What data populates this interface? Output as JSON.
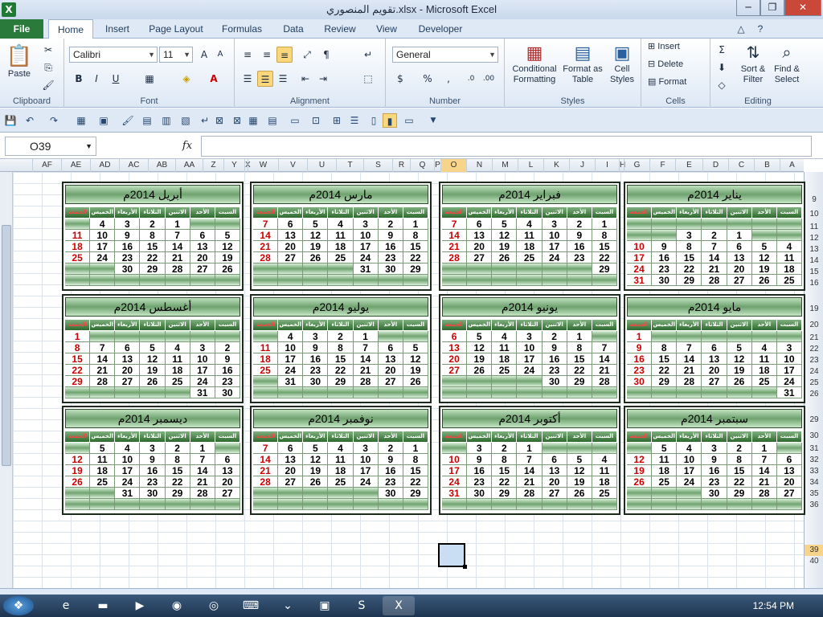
{
  "window": {
    "title": "تقويم المنصوري.xlsx  -  Microsoft Excel",
    "app_icon": "X"
  },
  "ribbon_tabs": [
    "File",
    "Home",
    "Insert",
    "Page Layout",
    "Formulas",
    "Data",
    "Review",
    "View",
    "Developer"
  ],
  "ribbon": {
    "clipboard": {
      "label": "Clipboard",
      "paste": "Paste"
    },
    "font": {
      "label": "Font",
      "name": "Calibri",
      "size": "11"
    },
    "alignment": {
      "label": "Alignment"
    },
    "number": {
      "label": "Number",
      "format": "General"
    },
    "styles": {
      "label": "Styles",
      "conditional": "Conditional Formatting",
      "table": "Format as Table",
      "cell": "Cell Styles"
    },
    "cells": {
      "label": "Cells",
      "insert": "Insert",
      "delete": "Delete",
      "format": "Format"
    },
    "editing": {
      "label": "Editing",
      "sort": "Sort & Filter",
      "find": "Find & Select"
    }
  },
  "formula_bar": {
    "name_box": "O39",
    "fx": "fx",
    "value": ""
  },
  "columns": [
    "AF",
    "AE",
    "AD",
    "AC",
    "AB",
    "AA",
    "Z",
    "Y",
    "X",
    "W",
    "V",
    "U",
    "T",
    "S",
    "R",
    "Q",
    "P",
    "O",
    "N",
    "M",
    "L",
    "K",
    "J",
    "I",
    "H",
    "G",
    "F",
    "E",
    "D",
    "C",
    "B",
    "A"
  ],
  "selected_column": "O",
  "rows": [
    "9",
    "10",
    "11",
    "12",
    "13",
    "14",
    "15",
    "16",
    "19",
    "20",
    "21",
    "22",
    "23",
    "24",
    "25",
    "26",
    "29",
    "30",
    "31",
    "32",
    "33",
    "34",
    "35",
    "36",
    "39",
    "40"
  ],
  "selected_row": "39",
  "weekdays": [
    "السبت",
    "الأحد",
    "الاثنين",
    "الثلاثاء",
    "الأربعاء",
    "الخميس",
    "الجمعة"
  ],
  "months": [
    {
      "name": "يناير  2014م",
      "weeks": [
        [
          null,
          null,
          null,
          null,
          null,
          null,
          null
        ],
        [
          "",
          "",
          "1",
          "2",
          "3"
        ],
        [
          "4",
          "5",
          "6",
          "7",
          "8",
          "9",
          "10"
        ],
        [
          "11",
          "12",
          "13",
          "14",
          "15",
          "16",
          "17"
        ],
        [
          "18",
          "19",
          "20",
          "21",
          "22",
          "23",
          "24"
        ],
        [
          "25",
          "26",
          "27",
          "28",
          "29",
          "30",
          "31"
        ]
      ]
    },
    {
      "name": "فبراير  2014م",
      "weeks": [
        [
          "1",
          "2",
          "3",
          "4",
          "5",
          "6",
          "7"
        ],
        [
          "8",
          "9",
          "10",
          "11",
          "12",
          "13",
          "14"
        ],
        [
          "15",
          "16",
          "17",
          "18",
          "19",
          "20",
          "21"
        ],
        [
          "22",
          "23",
          "24",
          "25",
          "26",
          "27",
          "28"
        ],
        [
          "29",
          "",
          "",
          "",
          "",
          "",
          ""
        ],
        [
          "",
          "",
          "",
          "",
          "",
          "",
          ""
        ]
      ]
    },
    {
      "name": "مارس  2014م",
      "weeks": [
        [
          "1",
          "2",
          "3",
          "4",
          "5",
          "6",
          "7"
        ],
        [
          "8",
          "9",
          "10",
          "11",
          "12",
          "13",
          "14"
        ],
        [
          "15",
          "16",
          "17",
          "18",
          "19",
          "20",
          "21"
        ],
        [
          "22",
          "23",
          "24",
          "25",
          "26",
          "27",
          "28"
        ],
        [
          "29",
          "30",
          "31",
          "",
          "",
          "",
          ""
        ],
        [
          "",
          "",
          "",
          "",
          "",
          "",
          ""
        ]
      ]
    },
    {
      "name": "أبريل  2014م",
      "weeks": [
        [
          "",
          "",
          "1",
          "2",
          "3",
          "4"
        ],
        [
          "5",
          "6",
          "7",
          "8",
          "9",
          "10",
          "11"
        ],
        [
          "12",
          "13",
          "14",
          "15",
          "16",
          "17",
          "18"
        ],
        [
          "19",
          "20",
          "21",
          "22",
          "23",
          "24",
          "25"
        ],
        [
          "26",
          "27",
          "28",
          "29",
          "30",
          "",
          ""
        ],
        [
          "",
          "",
          "",
          "",
          "",
          "",
          ""
        ]
      ]
    },
    {
      "name": "مايو  2014م",
      "weeks": [
        [
          "",
          "",
          "",
          "",
          "",
          "",
          "1",
          "2"
        ],
        [
          "3",
          "4",
          "5",
          "6",
          "7",
          "8",
          "9"
        ],
        [
          "10",
          "11",
          "12",
          "13",
          "14",
          "15",
          "16"
        ],
        [
          "17",
          "18",
          "19",
          "20",
          "21",
          "22",
          "23"
        ],
        [
          "24",
          "25",
          "26",
          "27",
          "28",
          "29",
          "30"
        ],
        [
          "31",
          "",
          "",
          "",
          "",
          "",
          ""
        ]
      ]
    },
    {
      "name": "يونيو  2014م",
      "weeks": [
        [
          "",
          "1",
          "2",
          "3",
          "4",
          "5",
          "6"
        ],
        [
          "7",
          "8",
          "9",
          "10",
          "11",
          "12",
          "13"
        ],
        [
          "14",
          "15",
          "16",
          "17",
          "18",
          "19",
          "20"
        ],
        [
          "21",
          "22",
          "23",
          "24",
          "25",
          "26",
          "27"
        ],
        [
          "28",
          "29",
          "30",
          "",
          "",
          "",
          ""
        ],
        [
          "",
          "",
          "",
          "",
          "",
          "",
          ""
        ]
      ]
    },
    {
      "name": "يوليو  2014م",
      "weeks": [
        [
          "",
          "",
          "1",
          "2",
          "3",
          "4"
        ],
        [
          "5",
          "6",
          "7",
          "8",
          "9",
          "10",
          "11"
        ],
        [
          "12",
          "13",
          "14",
          "15",
          "16",
          "17",
          "18"
        ],
        [
          "19",
          "20",
          "21",
          "22",
          "23",
          "24",
          "25"
        ],
        [
          "26",
          "27",
          "28",
          "29",
          "30",
          "31",
          ""
        ],
        [
          "",
          "",
          "",
          "",
          "",
          "",
          ""
        ]
      ]
    },
    {
      "name": "أغسطس  2014م",
      "weeks": [
        [
          "",
          "",
          "",
          "",
          "",
          "",
          "1"
        ],
        [
          "2",
          "3",
          "4",
          "5",
          "6",
          "7",
          "8"
        ],
        [
          "9",
          "10",
          "11",
          "12",
          "13",
          "14",
          "15"
        ],
        [
          "16",
          "17",
          "18",
          "19",
          "20",
          "21",
          "22"
        ],
        [
          "23",
          "24",
          "25",
          "26",
          "27",
          "28",
          "29"
        ],
        [
          "30",
          "31",
          "",
          "",
          "",
          "",
          ""
        ]
      ]
    },
    {
      "name": "سبتمبر  2014م",
      "weeks": [
        [
          "",
          "1",
          "2",
          "3",
          "4",
          "5"
        ],
        [
          "6",
          "7",
          "8",
          "9",
          "10",
          "11",
          "12"
        ],
        [
          "13",
          "14",
          "15",
          "16",
          "17",
          "18",
          "19"
        ],
        [
          "20",
          "21",
          "22",
          "23",
          "24",
          "25",
          "26"
        ],
        [
          "27",
          "28",
          "29",
          "30",
          "",
          "",
          ""
        ],
        [
          "",
          "",
          "",
          "",
          "",
          "",
          ""
        ]
      ]
    },
    {
      "name": "أكتوبر  2014م",
      "weeks": [
        [
          "",
          "",
          "",
          "1",
          "2",
          "3"
        ],
        [
          "4",
          "5",
          "6",
          "7",
          "8",
          "9",
          "10"
        ],
        [
          "11",
          "12",
          "13",
          "14",
          "15",
          "16",
          "17"
        ],
        [
          "18",
          "19",
          "20",
          "21",
          "22",
          "23",
          "24"
        ],
        [
          "25",
          "26",
          "27",
          "28",
          "29",
          "30",
          "31"
        ],
        [
          "",
          "",
          "",
          "",
          "",
          "",
          ""
        ]
      ]
    },
    {
      "name": "نوفمبر  2014م",
      "weeks": [
        [
          "1",
          "2",
          "3",
          "4",
          "5",
          "6",
          "7"
        ],
        [
          "8",
          "9",
          "10",
          "11",
          "12",
          "13",
          "14"
        ],
        [
          "15",
          "16",
          "17",
          "18",
          "19",
          "20",
          "21"
        ],
        [
          "22",
          "23",
          "24",
          "25",
          "26",
          "27",
          "28"
        ],
        [
          "29",
          "30",
          "",
          "",
          "",
          "",
          ""
        ],
        [
          "",
          "",
          "",
          "",
          "",
          "",
          ""
        ]
      ]
    },
    {
      "name": "ديسمبر  2014م",
      "weeks": [
        [
          "",
          "1",
          "2",
          "3",
          "4",
          "5"
        ],
        [
          "6",
          "7",
          "8",
          "9",
          "10",
          "11",
          "12"
        ],
        [
          "13",
          "14",
          "15",
          "16",
          "17",
          "18",
          "19"
        ],
        [
          "20",
          "21",
          "22",
          "23",
          "24",
          "25",
          "26"
        ],
        [
          "27",
          "28",
          "29",
          "30",
          "31",
          "",
          ""
        ],
        [
          "",
          "",
          "",
          "",
          "",
          "",
          ""
        ]
      ]
    }
  ],
  "taskbar": {
    "clock": "12:54 PM"
  }
}
